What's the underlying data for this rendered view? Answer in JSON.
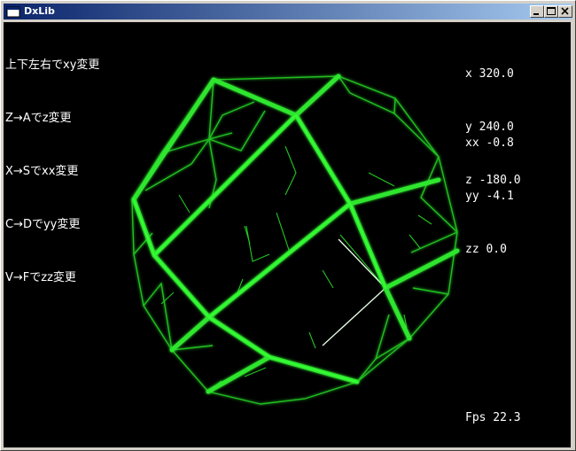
{
  "window": {
    "title": "DxLib"
  },
  "help": {
    "lines": [
      "上下左右でxy変更",
      "Z→Aでz変更",
      "X→Sでxx変更",
      "C→Dでyy変更",
      "V→Fでzz変更"
    ]
  },
  "values": {
    "x": "x 320.0",
    "y": "y 240.0",
    "z": "z -180.0",
    "xx": "xx -0.8",
    "yy": "yy -4.1",
    "zz": "zz 0.0"
  },
  "fps": "Fps 22.3",
  "colors": {
    "wire": "#2ad62a",
    "wire_bright": "#3cff3c",
    "background": "#000000"
  }
}
